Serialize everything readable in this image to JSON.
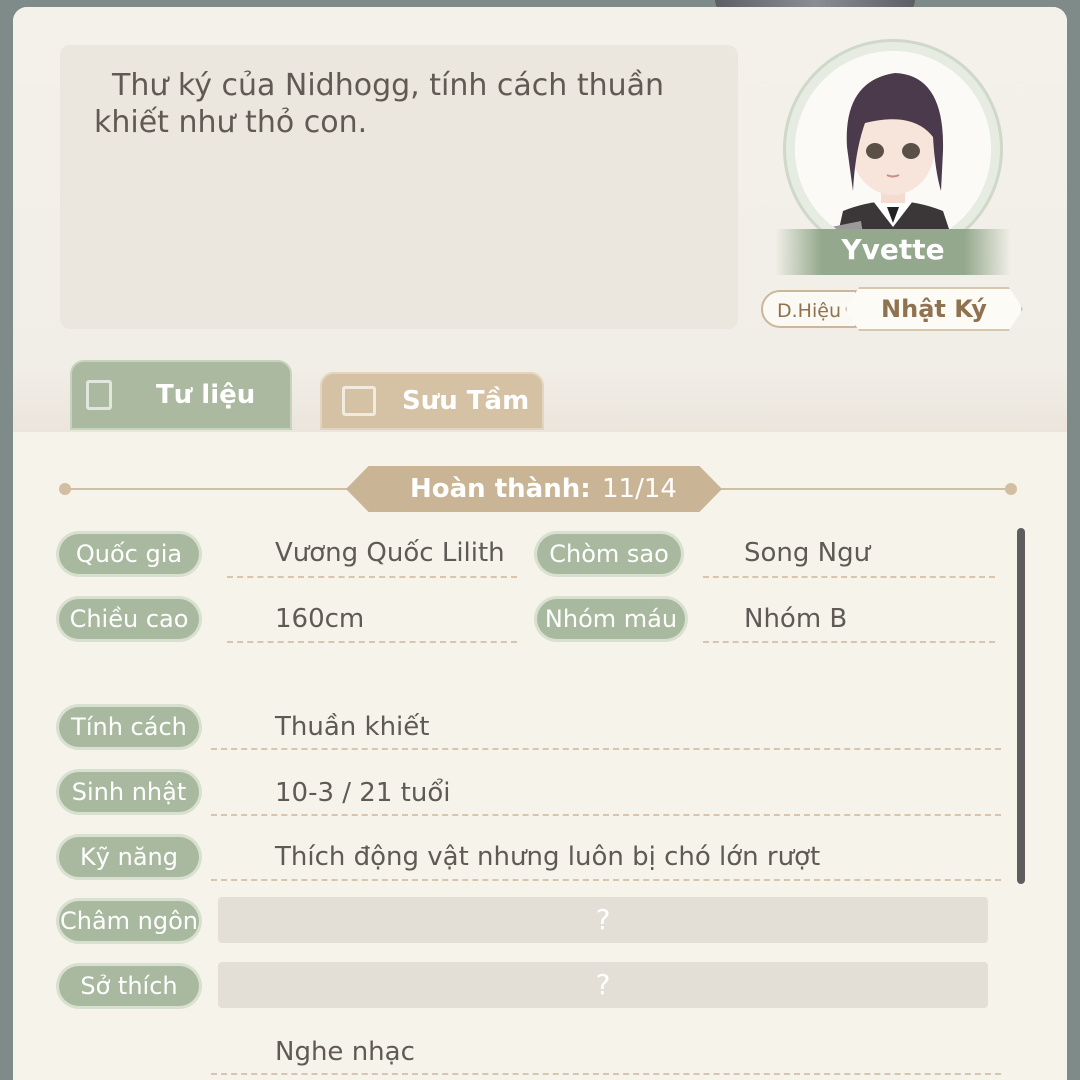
{
  "description": "Thư ký của Nidhogg, tính cách thuần khiết như thỏ con.",
  "character": {
    "name": "Yvette"
  },
  "buttons": {
    "dhieu": "D.Hiệu",
    "nhatky": "Nhật Ký"
  },
  "tabs": [
    {
      "label": "Tư liệu",
      "icon": "document-icon"
    },
    {
      "label": "Sưu Tầm",
      "icon": "book-icon"
    }
  ],
  "progress": {
    "label": "Hoàn thành:",
    "value": "11/14"
  },
  "info": {
    "quocgia": {
      "label": "Quốc gia",
      "value": "Vương Quốc Lilith"
    },
    "chomsao": {
      "label": "Chòm sao",
      "value": "Song Ngư"
    },
    "chieucao": {
      "label": "Chiều cao",
      "value": "160cm"
    },
    "nhommau": {
      "label": "Nhóm máu",
      "value": "Nhóm B"
    },
    "tinhcach": {
      "label": "Tính cách",
      "value": "Thuần khiết"
    },
    "sinhnhat": {
      "label": "Sinh nhật",
      "value": "10-3 / 21 tuổi"
    },
    "kynang": {
      "label": "Kỹ năng",
      "value": "Thích động vật nhưng luôn bị chó lớn rượt"
    },
    "chamngon": {
      "label": "Châm ngôn",
      "value": "?"
    },
    "sothich": {
      "label": "Sở thích",
      "value": "?"
    },
    "extra": {
      "value": "Nghe nhạc"
    }
  },
  "colors": {
    "accent_green": "#a8b99f",
    "accent_tan": "#c9b596",
    "panel": "#f6f3ea"
  }
}
